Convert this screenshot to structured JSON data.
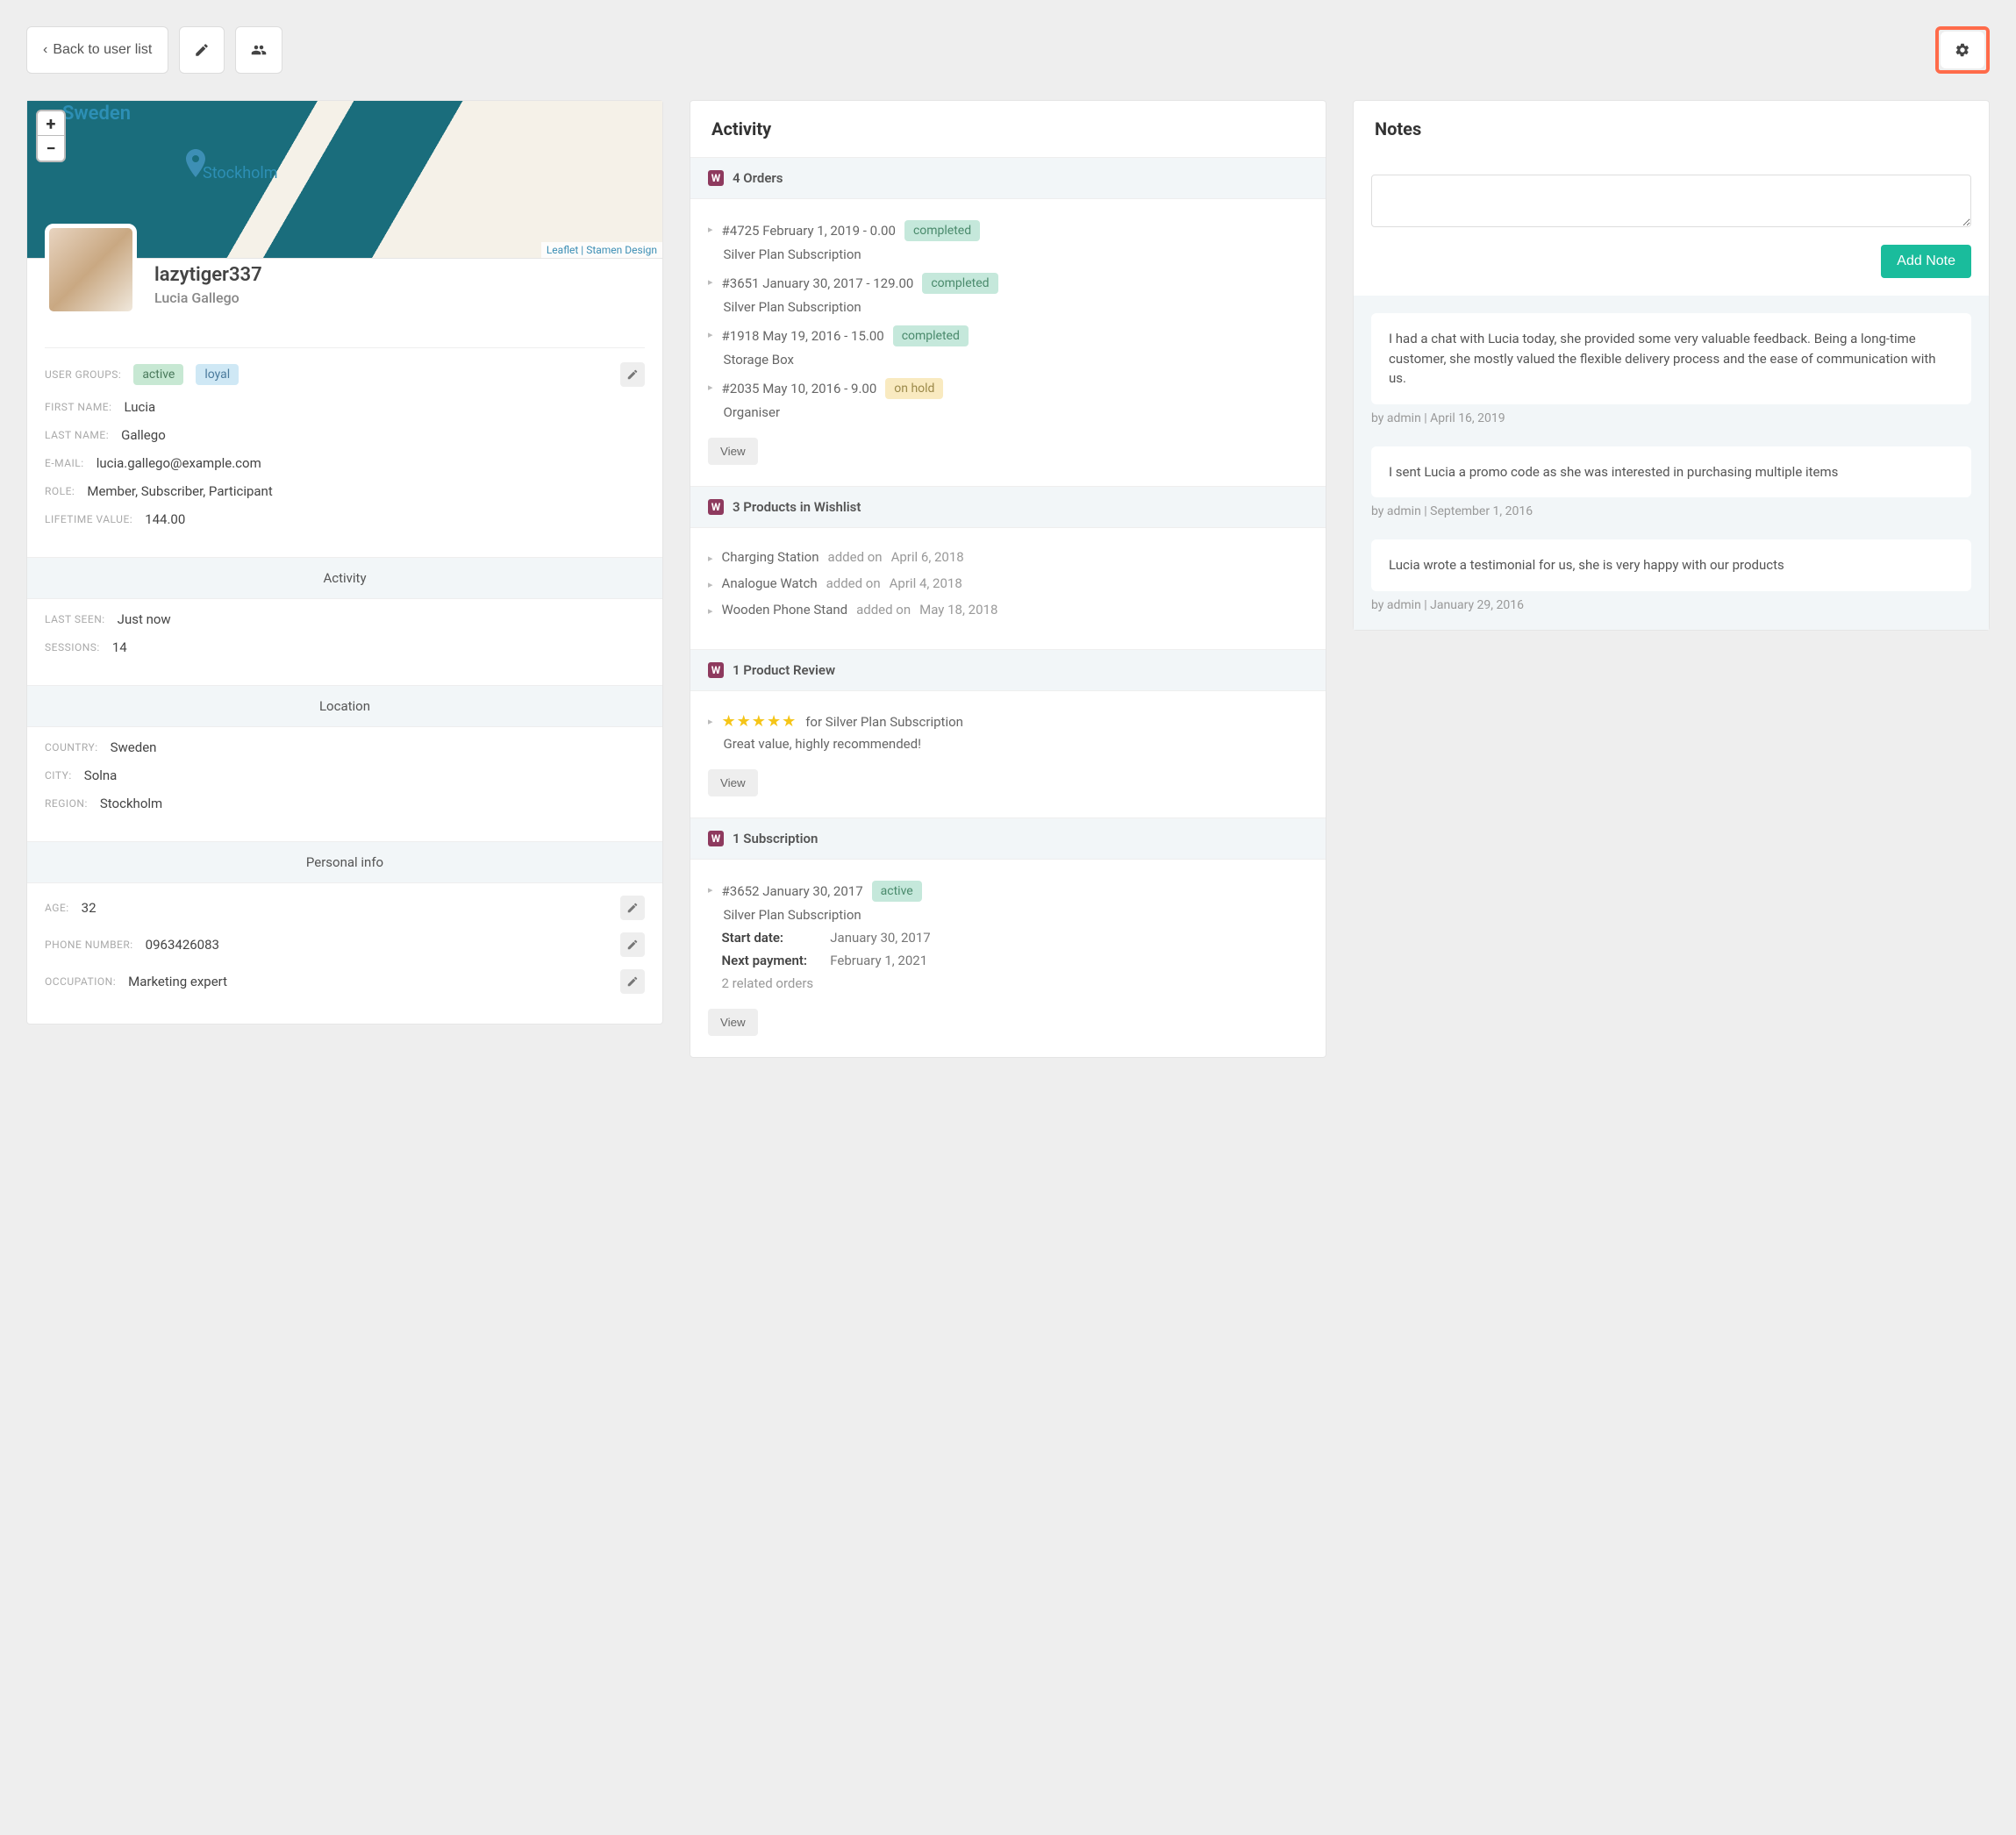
{
  "topbar": {
    "back_label": "Back to user list"
  },
  "map": {
    "country_label": "Sweden",
    "city_label": "Stockholm",
    "attribution_leaflet": "Leaflet",
    "attribution_stamen": "Stamen Design"
  },
  "profile": {
    "username": "lazytiger337",
    "fullname": "Lucia Gallego",
    "groups_label": "USER GROUPS:",
    "group_active": "active",
    "group_loyal": "loyal",
    "first_name_label": "FIRST NAME:",
    "first_name": "Lucia",
    "last_name_label": "LAST NAME:",
    "last_name": "Gallego",
    "email_label": "E-MAIL:",
    "email": "lucia.gallego@example.com",
    "role_label": "ROLE:",
    "role": "Member, Subscriber, Participant",
    "ltv_label": "LIFETIME VALUE:",
    "ltv": "144.00"
  },
  "activity": {
    "header": "Activity",
    "last_seen_label": "LAST SEEN:",
    "last_seen": "Just now",
    "sessions_label": "SESSIONS:",
    "sessions": "14"
  },
  "location": {
    "header": "Location",
    "country_label": "COUNTRY:",
    "country": "Sweden",
    "city_label": "CITY:",
    "city": "Solna",
    "region_label": "REGION:",
    "region": "Stockholm"
  },
  "personal": {
    "header": "Personal info",
    "age_label": "AGE:",
    "age": "32",
    "phone_label": "PHONE NUMBER:",
    "phone": "0963426083",
    "occupation_label": "OCCUPATION:",
    "occupation": "Marketing expert"
  },
  "middle": {
    "title": "Activity",
    "orders_header": "4 Orders",
    "orders": [
      {
        "line": "#4725 February 1, 2019 - 0.00",
        "status": "completed",
        "desc": "Silver Plan Subscription"
      },
      {
        "line": "#3651 January 30, 2017 - 129.00",
        "status": "completed",
        "desc": "Silver Plan Subscription"
      },
      {
        "line": "#1918 May 19, 2016 - 15.00",
        "status": "completed",
        "desc": "Storage Box"
      },
      {
        "line": "#2035 May 10, 2016 - 9.00",
        "status": "on hold",
        "desc": "Organiser"
      }
    ],
    "wishlist_header": "3 Products in Wishlist",
    "wishlist": [
      {
        "name": "Charging Station",
        "added": " added on ",
        "date": "April 6, 2018"
      },
      {
        "name": "Analogue Watch",
        "added": " added on ",
        "date": "April 4, 2018"
      },
      {
        "name": "Wooden Phone Stand",
        "added": " added on ",
        "date": "May 18, 2018"
      }
    ],
    "review_header": "1 Product Review",
    "review": {
      "for_text": " for Silver Plan Subscription",
      "body": "Great value, highly recommended!"
    },
    "sub_header": "1 Subscription",
    "subscription": {
      "line": "#3652 January 30, 2017",
      "status": "active",
      "desc": "Silver Plan Subscription",
      "start_label": "Start date:",
      "start_value": "January 30, 2017",
      "next_label": "Next payment:",
      "next_value": "February 1, 2021",
      "related": "2 related orders"
    },
    "view_label": "View"
  },
  "notes": {
    "title": "Notes",
    "add_label": "Add Note",
    "items": [
      {
        "text": "I had a chat with Lucia today, she provided some very valuable feedback. Being a long-time customer, she mostly valued the flexible delivery process and the ease of communication with us.",
        "meta": "by admin | April 16, 2019"
      },
      {
        "text": "I sent Lucia a promo code as she was interested in purchasing multiple items",
        "meta": "by admin | September 1, 2016"
      },
      {
        "text": "Lucia wrote a testimonial for us, she is very happy with our products",
        "meta": "by admin | January 29, 2016"
      }
    ]
  }
}
